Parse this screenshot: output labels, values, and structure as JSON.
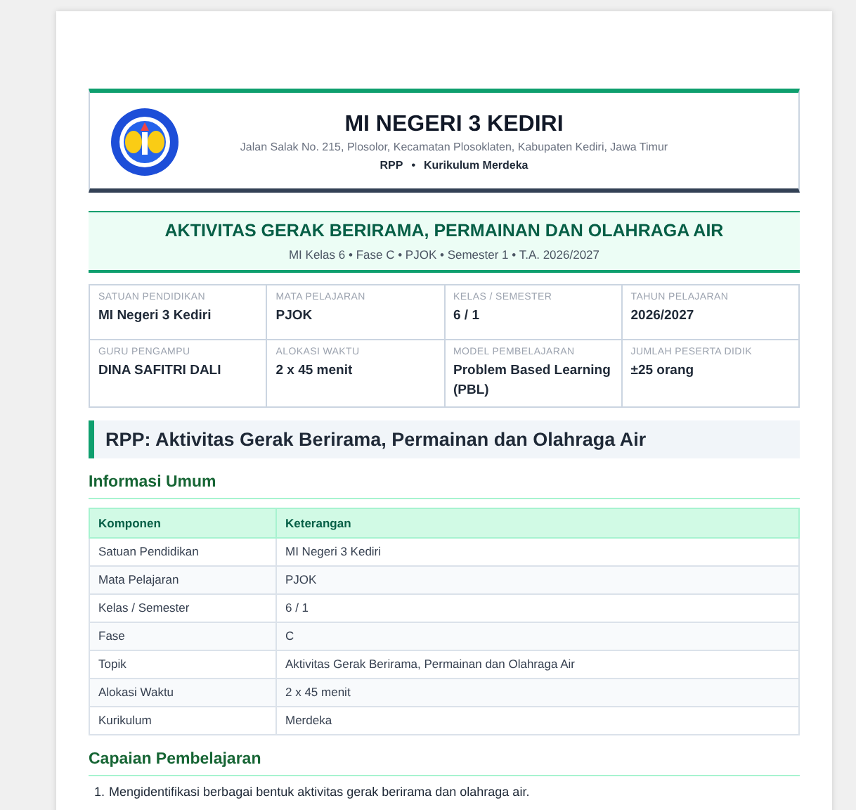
{
  "header": {
    "school": "MI NEGERI 3 KEDIRI",
    "address": "Jalan Salak No. 215, Plosolor, Kecamatan Plosoklaten, Kabupaten Kediri, Jawa Timur",
    "doc_type": "RPP",
    "separator": "•",
    "curriculum": "Kurikulum Merdeka"
  },
  "banner": {
    "title": "AKTIVITAS GERAK BERIRAMA, PERMAINAN DAN OLAHRAGA AIR",
    "subtitle": "MI Kelas 6 • Fase C • PJOK • Semester 1 • T.A. 2026/2027"
  },
  "info_grid": [
    {
      "label": "SATUAN PENDIDIKAN",
      "value": "MI Negeri 3 Kediri"
    },
    {
      "label": "MATA PELAJARAN",
      "value": "PJOK"
    },
    {
      "label": "KELAS / SEMESTER",
      "value": "6 / 1"
    },
    {
      "label": "TAHUN PELAJARAN",
      "value": "2026/2027"
    },
    {
      "label": "GURU PENGAMPU",
      "value": "DINA SAFITRI DALI"
    },
    {
      "label": "ALOKASI WAKTU",
      "value": "2 x 45 menit"
    },
    {
      "label": "MODEL PEMBELAJARAN",
      "value": "Problem Based Learning (PBL)"
    },
    {
      "label": "JUMLAH PESERTA DIDIK",
      "value": "±25 orang"
    }
  ],
  "section_title": "RPP: Aktivitas Gerak Berirama, Permainan dan Olahraga Air",
  "informasi_umum": {
    "heading": "Informasi Umum",
    "columns": [
      "Komponen",
      "Keterangan"
    ],
    "rows": [
      [
        "Satuan Pendidikan",
        "MI Negeri 3 Kediri"
      ],
      [
        "Mata Pelajaran",
        "PJOK"
      ],
      [
        "Kelas / Semester",
        "6 / 1"
      ],
      [
        "Fase",
        "C"
      ],
      [
        "Topik",
        "Aktivitas Gerak Berirama, Permainan dan Olahraga Air"
      ],
      [
        "Alokasi Waktu",
        "2 x 45 menit"
      ],
      [
        "Kurikulum",
        "Merdeka"
      ]
    ]
  },
  "capaian": {
    "heading": "Capaian Pembelajaran",
    "items": [
      {
        "number": "1.",
        "text": "Mengidentifikasi berbagai bentuk aktivitas gerak berirama dan olahraga air."
      }
    ]
  }
}
